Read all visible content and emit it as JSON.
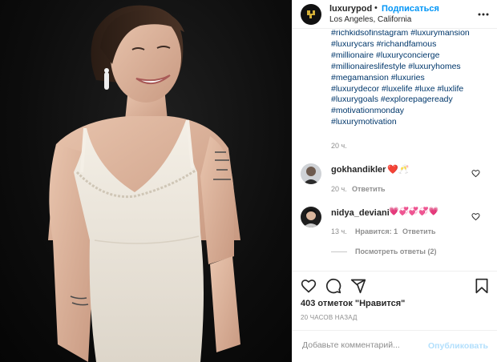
{
  "post": {
    "username": "luxurypod",
    "separator": "•",
    "follow_label": "Подписаться",
    "location": "Los Angeles, California",
    "hashtags": [
      "#richkidsofinstagram",
      "#luxurymansion",
      "#luxurycars",
      "#richandfamous",
      "#millionaire",
      "#luxuryconcierge",
      "#millionaireslifestyle",
      "#luxuryhomes",
      "#megamansion",
      "#luxuries",
      "#luxurydecor",
      "#luxelife",
      "#luxe",
      "#luxlife",
      "#luxurygoals",
      "#explorepageready",
      "#motivationmonday",
      "#luxurymotivation"
    ],
    "time": "20 ч.",
    "likes_text": "403 отметок \"Нравится\"",
    "posted_ago": "20 ЧАСОВ НАЗАД"
  },
  "comments": [
    {
      "username": "gokhandikler",
      "text": "❤️🥂",
      "time": "20 ч.",
      "reply_label": "Ответить"
    },
    {
      "username": "nidya_deviani",
      "text": "💗💞💞💞💗",
      "time": "13 ч.",
      "likes_label": "Нравится: 1",
      "reply_label": "Ответить"
    }
  ],
  "view_replies": "Посмотреть ответы (2)",
  "comment_box": {
    "placeholder": "Добавьте комментарий...",
    "publish_label": "Опубликовать"
  },
  "colors": {
    "link": "#0095f6",
    "hashtag": "#00376b",
    "muted": "#8e8e8e",
    "publish_disabled": "#b2dffc",
    "heart": "#ed4956"
  },
  "icons": {
    "logo": "luxurypod-logo",
    "more": "more-horizontal-icon",
    "like": "heart-icon",
    "comment": "comment-icon",
    "share": "share-icon",
    "save": "bookmark-icon"
  }
}
